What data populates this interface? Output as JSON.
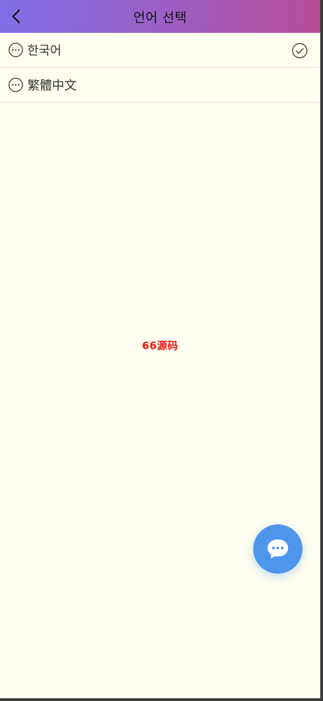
{
  "header": {
    "title": "언어 선택",
    "back_icon": "chevron-left-icon"
  },
  "languages": [
    {
      "label": "한국어",
      "icon": "more-horizontal-circle-icon",
      "selected": true
    },
    {
      "label": "繁體中文",
      "icon": "more-horizontal-circle-icon",
      "selected": false
    }
  ],
  "watermark": "66源码",
  "chat_button": {
    "icon": "chat-bubble-icon"
  },
  "colors": {
    "header_gradient_start": "#7f6fe6",
    "header_gradient_end": "#b84d96",
    "background": "#fffef0",
    "fab": "#4d96ec",
    "watermark": "#ee1111"
  }
}
